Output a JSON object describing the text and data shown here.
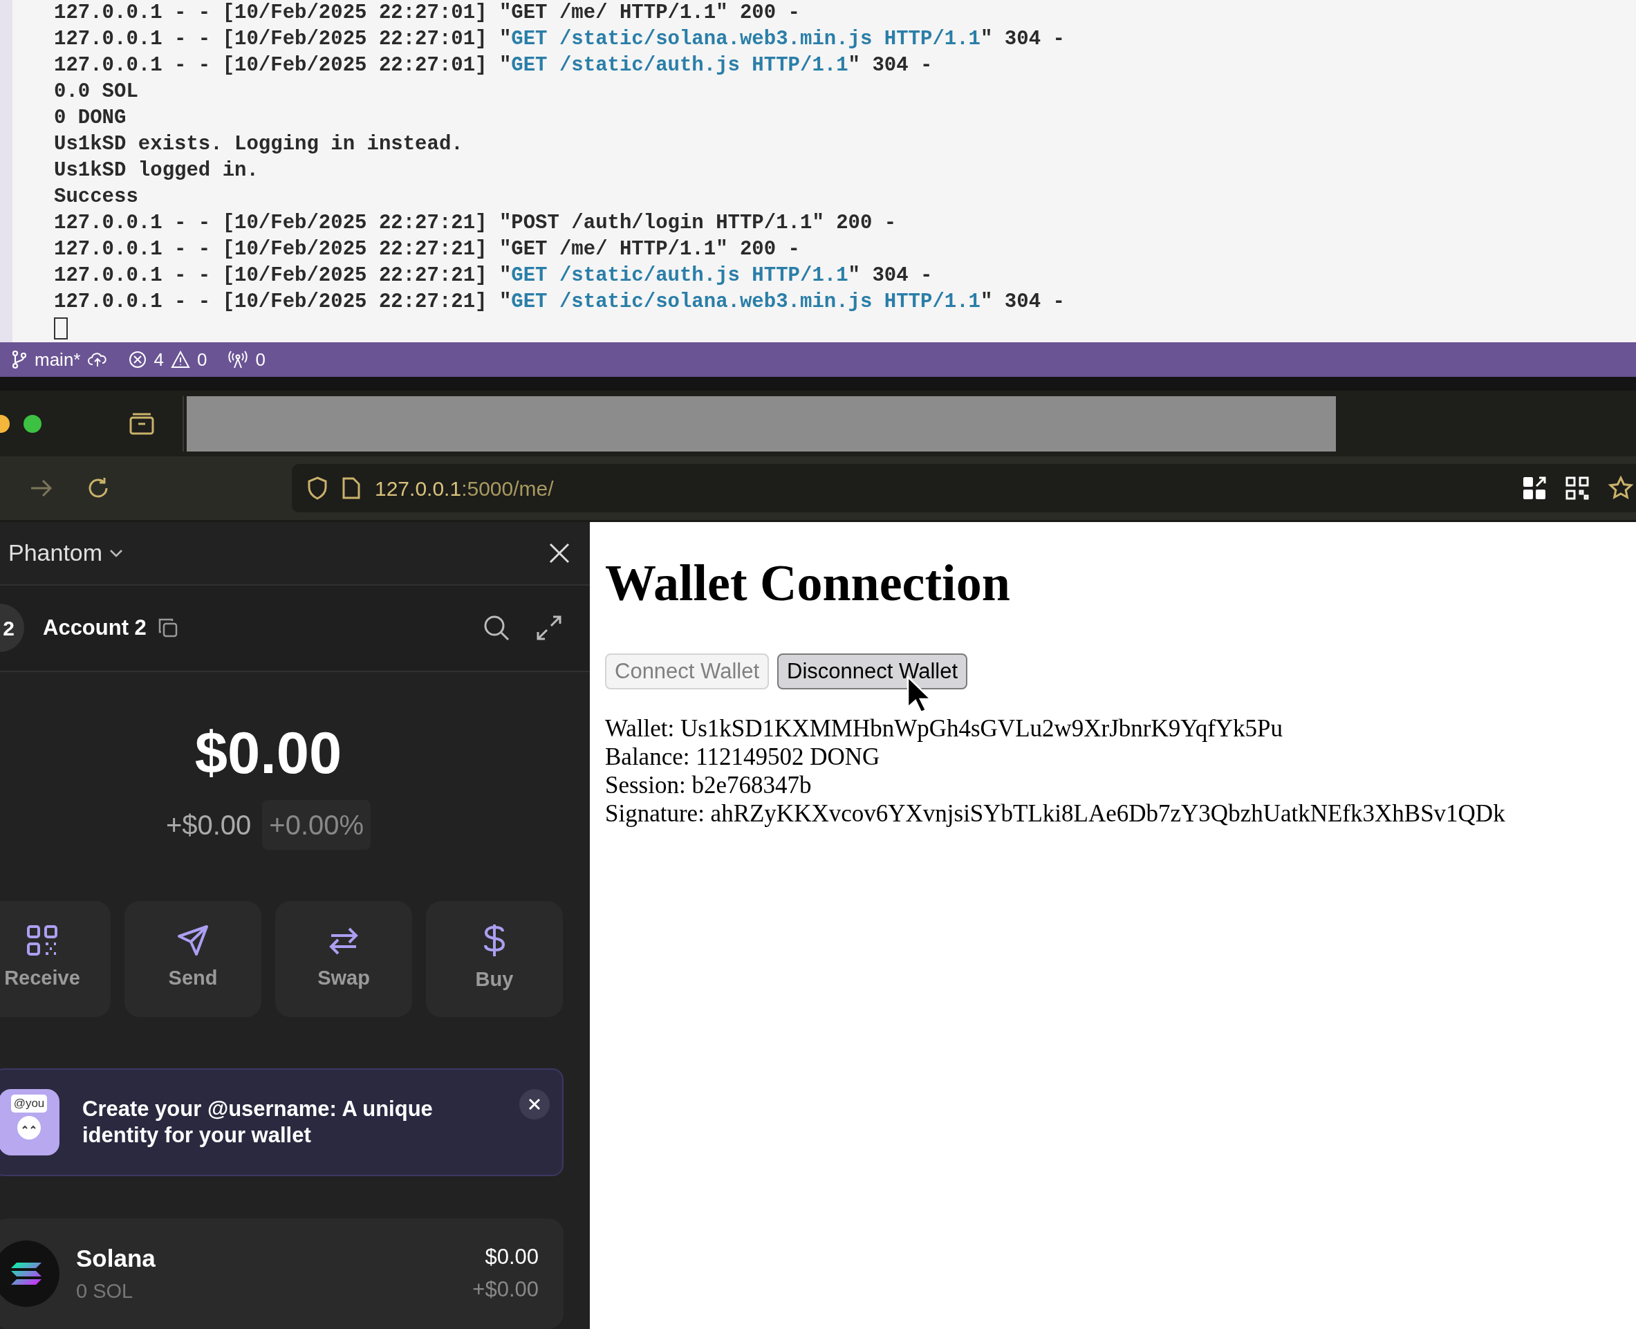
{
  "terminal": {
    "lines": [
      [
        {
          "text": "127.0.0.1 - - [10/Feb/2025 22:27:01] \"GET /me/ HTTP/1.1\" 200 -",
          "highlighted": false
        }
      ],
      [
        {
          "text": "127.0.0.1 - - [10/Feb/2025 22:27:01] \"",
          "highlighted": false
        },
        {
          "text": "GET /static/solana.web3.min.js HTTP/1.1",
          "highlighted": true
        },
        {
          "text": "\" 304 -",
          "highlighted": false
        }
      ],
      [
        {
          "text": "127.0.0.1 - - [10/Feb/2025 22:27:01] \"",
          "highlighted": false
        },
        {
          "text": "GET /static/auth.js HTTP/1.1",
          "highlighted": true
        },
        {
          "text": "\" 304 -",
          "highlighted": false
        }
      ],
      [
        {
          "text": "0.0 SOL",
          "highlighted": false
        }
      ],
      [
        {
          "text": "0 DONG",
          "highlighted": false
        }
      ],
      [
        {
          "text": "Us1kSD exists. Logging in instead.",
          "highlighted": false
        }
      ],
      [
        {
          "text": "Us1kSD logged in.",
          "highlighted": false
        }
      ],
      [
        {
          "text": "Success",
          "highlighted": false
        }
      ],
      [
        {
          "text": "127.0.0.1 - - [10/Feb/2025 22:27:21] \"POST /auth/login HTTP/1.1\" 200 -",
          "highlighted": false
        }
      ],
      [
        {
          "text": "127.0.0.1 - - [10/Feb/2025 22:27:21] \"GET /me/ HTTP/1.1\" 200 -",
          "highlighted": false
        }
      ],
      [
        {
          "text": "127.0.0.1 - - [10/Feb/2025 22:27:21] \"",
          "highlighted": false
        },
        {
          "text": "GET /static/auth.js HTTP/1.1",
          "highlighted": true
        },
        {
          "text": "\" 304 -",
          "highlighted": false
        }
      ],
      [
        {
          "text": "127.0.0.1 - - [10/Feb/2025 22:27:21] \"",
          "highlighted": false
        },
        {
          "text": "GET /static/solana.web3.min.js HTTP/1.1",
          "highlighted": true
        },
        {
          "text": "\" 304 -",
          "highlighted": false
        }
      ]
    ]
  },
  "status_bar": {
    "branch": "main*",
    "errors": "4",
    "warnings": "0",
    "ports": "0"
  },
  "browser": {
    "url_host": "127.0.0.1",
    "url_path": ":5000/me/"
  },
  "wallet_panel": {
    "title": "Phantom",
    "account_badge": "2",
    "account_name": "Account 2",
    "balance": "$0.00",
    "change_amount": "+$0.00",
    "change_percent": "+0.00%",
    "actions": [
      {
        "label": "Receive",
        "kind": "qr"
      },
      {
        "label": "Send",
        "kind": "send"
      },
      {
        "label": "Swap",
        "kind": "swap"
      },
      {
        "label": "Buy",
        "kind": "dollar"
      }
    ],
    "banner": {
      "badge": "@you",
      "text": "Create your @username: A unique identity for your wallet"
    },
    "tokens": [
      {
        "name": "Solana",
        "amount": "0 SOL",
        "value": "$0.00",
        "change": "+$0.00"
      }
    ]
  },
  "page": {
    "title": "Wallet Connection",
    "buttons": [
      {
        "label": "Connect Wallet",
        "disabled": true
      },
      {
        "label": "Disconnect Wallet",
        "disabled": false
      }
    ],
    "info_lines": [
      "Wallet: Us1kSD1KXMMHbnWpGh4sGVLu2w9XrJbnrK9YqfYk5Pu",
      "Balance: 112149502 DONG",
      "Session: b2e768347b",
      "Signature: ahRZyKKXvcov6YXvnjsiSYbTLki8LAe6Db7zY3QbzhUatkNEfk3XhBSv1QDk"
    ]
  }
}
